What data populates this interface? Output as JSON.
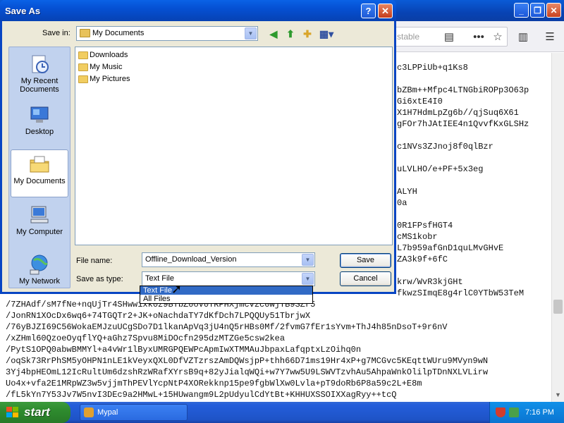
{
  "browser": {
    "url_text": "stable",
    "code_lines": [
      "c3LPPiUb+q1Ks8",
      "bZBm++Mfpc4LTNGbiROPp3O63p",
      "Gi6xtE4I0",
      "X1H7HdmLpZg6b//qjSuq6X61",
      "gFOr7hJAtIEE4n1QvvfKxGLSHz",
      "c1NVs3ZJnoj8f0qlBzr",
      "uLVLHO/e+PF+5x3eg",
      "ALYH",
      "0a",
      "0R1FPsfHGT4",
      "cMS1kobr",
      "L7b959afGnD1quLMvGHvE",
      "ZA3k9f+6fC",
      "krw/WvR3kjGHt",
      "fkwzSImqE8g4rlC0YTbW53TeM",
      "/7ZHAdf/sM7fNe+nqUjTr4SHww1xk0z9BTbZ0oV0TRPHXjmcvzc0wjTB9SZr5",
      "/JonRN1XOcDx6wq6+74TGQTr2+JK+oNachdaTY7dKfDch7LPQQUy51TbrjwX",
      "/76yBJZI69C56WokaEMJzuUCgSDo7D1lkanApVq3jU4nQ5rHBs0Mf/2fvmG7fEr1sYvm+ThJ4h85nDsoT+9r6nV",
      "/xZHml60QzoeOyqflYQ+aGhz7Spvu8MiDOcfn295dzMTZGe5csw2kea",
      "/PytS1OPQ0abwBMMYl+a4vWr1lByxUMRGPQEWPcApmIwXTMMAuJbpaxLafqptxLzOihq0n",
      "/oqSk73RrPhSM5yOHPN1nLE1kVeyxQXL0DfVZTzrszAmDQWsjpP+thh66D71ms19Hr4xP+g7MCGvc5KEqttWUru9MVyn9wN",
      "3Yj4bpHEOmL12IcRultUm6dzshRzWRafXYrsB9q+82yJialqWQi+w7Y7ww5U9LSWVTzvhAu5AhpaWnkOlilpTDnNXLVLirw",
      "Uo4x+vfa2E1MRpWZ3w5vjjmThPEVlYcpNtP4XORekknp15pe9fgbWlXw0Lvla+pT9doRb6P8a59c2L+E8m",
      "/fL5kYn7Y53Jv7W5nvI3DEc9a2HMwL+15HUwangm9L2pUdyulCdYtBt+KHHUXSSOIXXagRyy++tcQ"
    ]
  },
  "dialog": {
    "title": "Save As",
    "save_in_label": "Save in:",
    "save_in_value": "My Documents",
    "places": [
      {
        "label": "My Recent Documents",
        "icon": "recent-documents-icon"
      },
      {
        "label": "Desktop",
        "icon": "desktop-icon"
      },
      {
        "label": "My Documents",
        "icon": "my-documents-icon"
      },
      {
        "label": "My Computer",
        "icon": "my-computer-icon"
      },
      {
        "label": "My Network",
        "icon": "my-network-icon"
      }
    ],
    "files": [
      "Downloads",
      "My Music",
      "My Pictures"
    ],
    "file_name_label": "File name:",
    "file_name_value": "Offline_Download_Version",
    "save_as_type_label": "Save as type:",
    "save_as_type_value": "Text File",
    "type_options": [
      "Text File",
      "All Files"
    ],
    "save_button": "Save",
    "cancel_button": "Cancel"
  },
  "taskbar": {
    "start_label": "start",
    "task_label": "Mypal",
    "clock": "7:16 PM"
  },
  "colors": {
    "xp_title_blue": "#0550d3",
    "dialog_face": "#ece9d8",
    "places_bar": "#c1d2ee",
    "selection_blue": "#316ac5",
    "start_green": "#2e8b2e"
  }
}
